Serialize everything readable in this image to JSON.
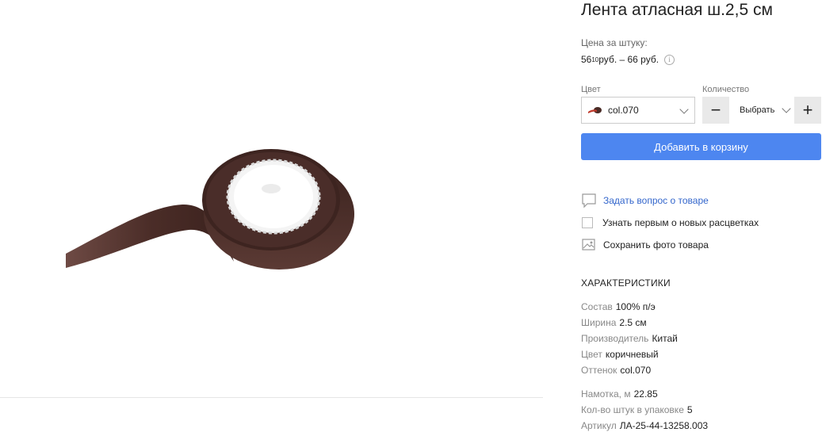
{
  "product": {
    "title": "Лента атласная ш.2,5 см",
    "price_label": "Цена за штуку:",
    "price_from_main": "56",
    "price_from_cents": "10",
    "price_rest": " руб. – 66 руб.",
    "info_glyph": "i"
  },
  "color": {
    "label": "Цвет",
    "value": "col.070",
    "swatch_color": "#4a2b26"
  },
  "quantity": {
    "label": "Количество",
    "minus": "−",
    "select_text": "Выбрать",
    "plus": "+"
  },
  "cart": {
    "add_label": "Добавить в корзину",
    "button_color": "#4d86f0"
  },
  "actions": {
    "ask": "Задать вопрос о товаре",
    "notify": "Узнать первым о новых расцветках",
    "save_photo": "Сохранить фото товара"
  },
  "specs": {
    "title": "ХАРАКТЕРИСТИКИ",
    "items": [
      {
        "k": "Состав",
        "v": "100% п/э"
      },
      {
        "k": "Ширина",
        "v": "2.5 см"
      },
      {
        "k": "Производитель",
        "v": "Китай"
      },
      {
        "k": "Цвет",
        "v": "коричневый"
      },
      {
        "k": "Оттенок",
        "v": "col.070"
      },
      {
        "k": "Намотка, м",
        "v": "22.85"
      },
      {
        "k": "Кол-во штук в упаковке",
        "v": "5"
      },
      {
        "k": "Артикул",
        "v": "ЛА-25-44-13258.003"
      }
    ]
  },
  "icons": {
    "ask": "chat-bubble-icon",
    "save": "image-download-icon",
    "info": "info-icon",
    "chevron": "chevron-down-icon"
  }
}
